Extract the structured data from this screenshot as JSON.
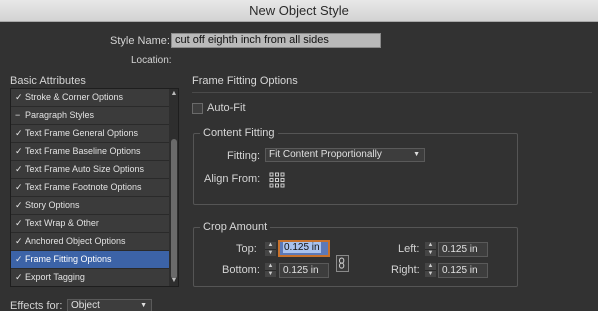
{
  "window": {
    "title": "New Object Style"
  },
  "general": {
    "style_name_label": "Style Name:",
    "style_name_value": "cut off eighth inch from all sides",
    "location_label": "Location:"
  },
  "basic_attributes": {
    "heading": "Basic Attributes",
    "items": [
      {
        "label": "Stroke & Corner Options",
        "state": "checked"
      },
      {
        "label": "Paragraph Styles",
        "state": "mixed"
      },
      {
        "label": "Text Frame General Options",
        "state": "checked"
      },
      {
        "label": "Text Frame Baseline Options",
        "state": "checked"
      },
      {
        "label": "Text Frame Auto Size Options",
        "state": "checked"
      },
      {
        "label": "Text Frame Footnote Options",
        "state": "checked"
      },
      {
        "label": "Story Options",
        "state": "checked"
      },
      {
        "label": "Text Wrap & Other",
        "state": "checked"
      },
      {
        "label": "Anchored Object Options",
        "state": "checked"
      },
      {
        "label": "Frame Fitting Options",
        "state": "checked",
        "selected": true
      },
      {
        "label": "Export Tagging",
        "state": "checked"
      }
    ],
    "check_glyph": "✓",
    "mixed_glyph": "−"
  },
  "frame_fitting": {
    "heading": "Frame Fitting Options",
    "auto_fit_label": "Auto-Fit",
    "content_fitting": {
      "title": "Content Fitting",
      "fitting_label": "Fitting:",
      "fitting_value": "Fit Content Proportionally",
      "align_from_label": "Align From:"
    },
    "crop_amount": {
      "title": "Crop Amount",
      "top_label": "Top:",
      "top_value": "0.125 in",
      "bottom_label": "Bottom:",
      "bottom_value": "0.125 in",
      "left_label": "Left:",
      "left_value": "0.125 in",
      "right_label": "Right:",
      "right_value": "0.125 in"
    }
  },
  "effects": {
    "label": "Effects for:",
    "value": "Object"
  },
  "icons": {
    "dropdown": "▼",
    "spin_up": "▲",
    "spin_down": "▼",
    "chain": "chain-link-icon",
    "grid": "reference-point-grid-icon"
  }
}
